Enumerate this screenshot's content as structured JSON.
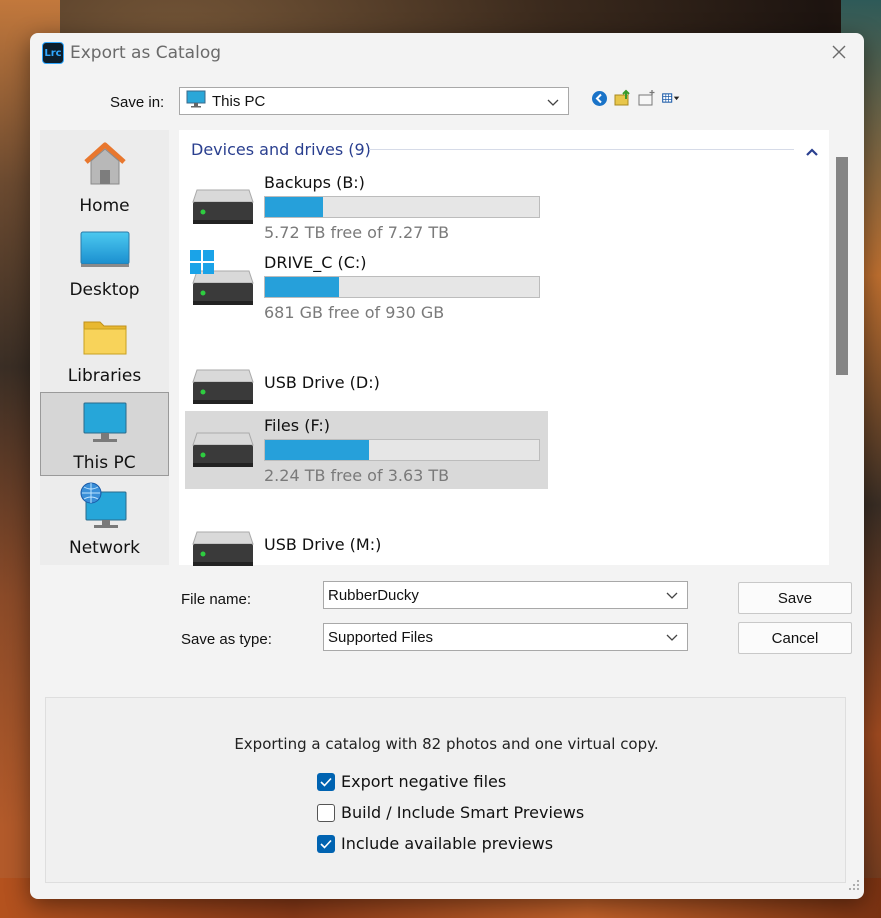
{
  "dialog": {
    "app_icon_text": "Lrc",
    "title": "Export as Catalog"
  },
  "save_in": {
    "label": "Save in:",
    "value": "This PC"
  },
  "toolbar": {
    "icons": [
      "back-icon",
      "up-folder-icon",
      "new-folder-icon",
      "view-menu-icon"
    ]
  },
  "places": [
    {
      "label": "Home",
      "icon": "home-icon"
    },
    {
      "label": "Desktop",
      "icon": "desktop-icon"
    },
    {
      "label": "Libraries",
      "icon": "libraries-icon"
    },
    {
      "label": "This PC",
      "icon": "this-pc-icon",
      "selected": true
    },
    {
      "label": "Network",
      "icon": "network-icon"
    }
  ],
  "group": {
    "header": "Devices and drives (9)"
  },
  "drives": [
    {
      "name": "Backups (B:)",
      "free": "5.72 TB free of 7.27 TB",
      "used_fraction": 0.21
    },
    {
      "name": "DRIVE_C (C:)",
      "free": "681 GB free of 930 GB",
      "used_fraction": 0.27,
      "windows": true
    },
    {
      "name": "USB Drive (D:)"
    },
    {
      "name": "Files (F:)",
      "free": "2.24 TB free of 3.63 TB",
      "used_fraction": 0.38,
      "selected": true
    },
    {
      "name": "USB Drive (M:)"
    }
  ],
  "file_name": {
    "label": "File name:",
    "value": "RubberDucky"
  },
  "save_as_type": {
    "label": "Save as type:",
    "value": "Supported Files"
  },
  "buttons": {
    "save": "Save",
    "cancel": "Cancel"
  },
  "options": {
    "info": "Exporting a catalog with 82 photos and one virtual copy.",
    "export_negatives": {
      "label": "Export negative files",
      "checked": true
    },
    "smart_previews": {
      "label": "Build / Include Smart Previews",
      "checked": false
    },
    "available_previews": {
      "label": "Include available previews",
      "checked": true
    }
  },
  "colors": {
    "accent": "#0063b1",
    "usage_bar": "#26a0da",
    "group_header": "#2a3f8f"
  }
}
